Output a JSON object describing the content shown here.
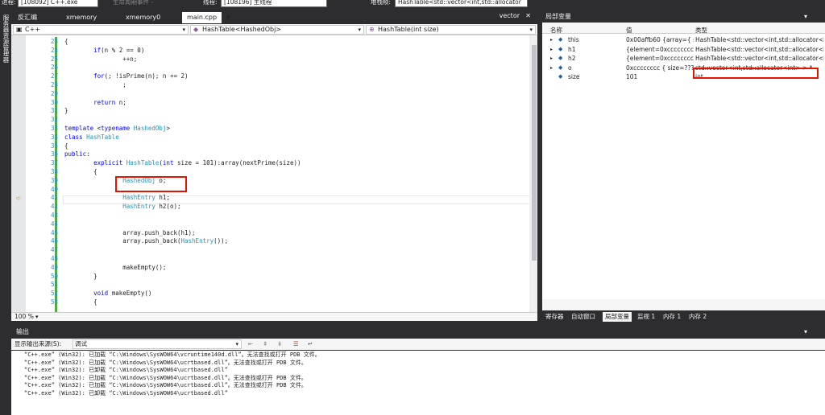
{
  "topbar": {
    "process_label": "进程:",
    "process_value": "[108092] C++.exe",
    "lifecycle_label": "生命周期事件 -",
    "thread_label": "线程:",
    "thread_value": "[108196] 主线程",
    "stack_label": "堆栈帧:",
    "stack_value": "HashTable<std::vector<int,std::allocator"
  },
  "leftstrip": {
    "label": "服务器资源管理器"
  },
  "tabs": [
    {
      "label": "反汇编"
    },
    {
      "label": "xmemory"
    },
    {
      "label": "xmemory0"
    },
    {
      "label": "main.cpp"
    }
  ],
  "tab_right": "vector",
  "nav": {
    "scope": "C++",
    "class": "HashTable<HashedObj>",
    "method": "HashTable(int size)"
  },
  "editor": {
    "line_numbers": [
      "23",
      "24",
      "25",
      "26",
      "27",
      "28",
      "29",
      "30",
      "31",
      "32",
      "33",
      "34",
      "35",
      "36",
      "37",
      "38",
      "39",
      "40",
      "41",
      "42",
      "43",
      "44",
      "45",
      "46",
      "47",
      "48",
      "49",
      "50",
      "51",
      "52",
      "53"
    ],
    "lines": [
      "{",
      "        if(n % 2 == 0)",
      "                ++n;",
      "",
      "        for(; !isPrime(n); n += 2)",
      "                ;",
      "",
      "        return n;",
      "}",
      "",
      "template <typename HashedObj>",
      "class HashTable",
      "{",
      "public:",
      "        explicit HashTable(int size = 101):array(nextPrime(size))",
      "        {",
      "                HashedObj o;",
      "",
      "                HashEntry h1;",
      "                HashEntry h2(o);",
      "",
      "",
      "                array.push_back(h1);",
      "                array.push_back(HashEntry());",
      "",
      "",
      "                makeEmpty();",
      "        }",
      "",
      "        void makeEmpty()",
      "        {"
    ]
  },
  "zoom": "100 %",
  "locals": {
    "title": "局部变量",
    "col_name": "名称",
    "col_value": "值",
    "col_type": "类型",
    "rows": [
      {
        "name": "this",
        "value": "0x00affb60 {array={ size",
        "type": "HashTable<std::vector<int,std::allocator<int"
      },
      {
        "name": "h1",
        "value": "{element=0xcccccccc {",
        "type": "HashTable<std::vector<int,std::allocator<int"
      },
      {
        "name": "h2",
        "value": "{element=0xcccccccc {",
        "type": "HashTable<std::vector<int,std::allocator<int"
      },
      {
        "name": "o",
        "value": "0xcccccccc { size=??? }",
        "type": "std::vector<int,std::allocator<int> > *"
      },
      {
        "name": "size",
        "value": "101",
        "type": "int"
      }
    ]
  },
  "debug_tabs": [
    "寄存器",
    "自动窗口",
    "局部变量",
    "监视 1",
    "内存 1",
    "内存 2"
  ],
  "output": {
    "title": "输出",
    "source_label": "显示输出来源(S):",
    "source_value": "调试",
    "lines": [
      "“C++.exe” (Win32): 已加载 “C:\\Windows\\SysWOW64\\vcruntime140d.dll”。无法查找或打开 PDB 文件。",
      "“C++.exe” (Win32): 已加载 “C:\\Windows\\SysWOW64\\ucrtbased.dll”。无法查找或打开 PDB 文件。",
      "“C++.exe” (Win32): 已卸载 “C:\\Windows\\SysWOW64\\ucrtbased.dll”",
      "“C++.exe” (Win32): 已加载 “C:\\Windows\\SysWOW64\\ucrtbased.dll”。无法查找或打开 PDB 文件。",
      "“C++.exe” (Win32): 已加载 “C:\\Windows\\SysWOW64\\ucrtbased.dll”。无法查找或打开 PDB 文件。",
      "“C++.exe” (Win32): 已卸载 “C:\\Windows\\SysWOW64\\ucrtbased.dll”"
    ]
  },
  "colors": {
    "keyword": "#0000ff",
    "type": "#2b91af",
    "highlight": "#e51400",
    "change_bar": "#57a64a"
  }
}
